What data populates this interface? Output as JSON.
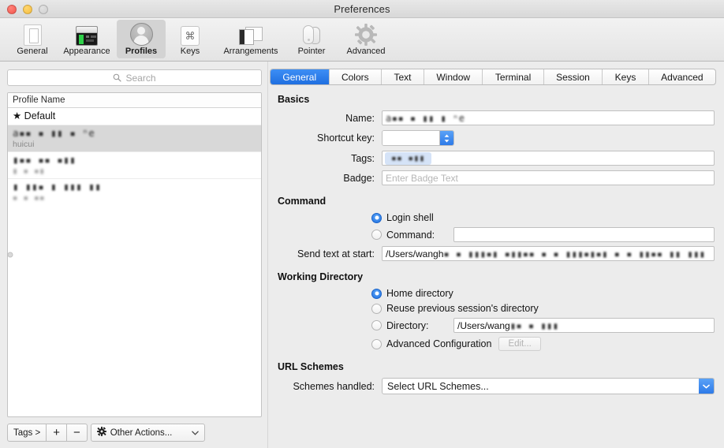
{
  "window": {
    "title": "Preferences",
    "traffic_lights": [
      "close",
      "minimize",
      "zoom"
    ]
  },
  "toolbar": {
    "items": [
      {
        "label": "General",
        "icon": "general-icon",
        "selected": false
      },
      {
        "label": "Appearance",
        "icon": "appearance-icon",
        "selected": false
      },
      {
        "label": "Profiles",
        "icon": "profiles-icon",
        "selected": true
      },
      {
        "label": "Keys",
        "icon": "keys-icon",
        "selected": false
      },
      {
        "label": "Arrangements",
        "icon": "arrangements-icon",
        "selected": false
      },
      {
        "label": "Pointer",
        "icon": "pointer-icon",
        "selected": false
      },
      {
        "label": "Advanced",
        "icon": "advanced-gear-icon",
        "selected": false
      }
    ]
  },
  "sidebar": {
    "search": {
      "placeholder": "Search",
      "value": "",
      "icon": "search-icon"
    },
    "list": {
      "column_header": "Profile Name",
      "rows": [
        {
          "title": "★ Default",
          "starred": true,
          "subtitle": "",
          "redacted": false,
          "selected": false
        },
        {
          "title": "a▪▪ ▪ ▮▮ ▪ ⁿe",
          "starred": false,
          "subtitle": "huicui",
          "redacted": true,
          "selected": true
        },
        {
          "title": "▮▪▪ ▪▪ ▪▮▮",
          "starred": false,
          "subtitle": "▮ ▪ ▪▮",
          "redacted": true,
          "selected": false
        },
        {
          "title": "▮ ▮▮▪ ▮ ▮▮▮ ▮▮",
          "starred": false,
          "subtitle": "▪ ▪ ▪▪",
          "redacted": true,
          "selected": false
        }
      ]
    },
    "buttons": {
      "tags": "Tags >",
      "add": "+",
      "remove": "−",
      "other_actions": "Other Actions...",
      "other_actions_icon": "gear-icon",
      "other_actions_chevron": "chevron-down-icon"
    }
  },
  "tabs": [
    {
      "label": "General",
      "active": true
    },
    {
      "label": "Colors",
      "active": false
    },
    {
      "label": "Text",
      "active": false
    },
    {
      "label": "Window",
      "active": false
    },
    {
      "label": "Terminal",
      "active": false
    },
    {
      "label": "Session",
      "active": false
    },
    {
      "label": "Keys",
      "active": false
    },
    {
      "label": "Advanced",
      "active": false
    }
  ],
  "general_tab": {
    "basics": {
      "heading": "Basics",
      "name": {
        "label": "Name:",
        "value": "a▪▪ ▪ ▮▮ ▮ ⁿe",
        "redacted": true
      },
      "shortcut_key": {
        "label": "Shortcut key:",
        "value": "",
        "stepper_icon": "stepper-up-down-icon"
      },
      "tags": {
        "label": "Tags:",
        "token": "▪▪ ▪▮▮",
        "redacted": true
      },
      "badge": {
        "label": "Badge:",
        "value": "",
        "placeholder": "Enter Badge Text"
      }
    },
    "command": {
      "heading": "Command",
      "login_shell": {
        "label": "Login shell",
        "selected": true
      },
      "command": {
        "label": "Command:",
        "selected": false,
        "value": ""
      },
      "send_text_at_start": {
        "label": "Send text at start:",
        "value_visible": "/Users/wangh",
        "value_redacted": "▪ ▪ ▮▮▮▪▮ ▪▮▮▪▪ ▪ ▪ ▮▮▮▪▮▪▮ ▪ ▪ ▮▮▪▪ ▮▮ ▮▮▮"
      }
    },
    "working_directory": {
      "heading": "Working Directory",
      "options": [
        {
          "label": "Home directory",
          "selected": true
        },
        {
          "label": "Reuse previous session's directory",
          "selected": false
        },
        {
          "label": "Directory:",
          "selected": false
        },
        {
          "label": "Advanced Configuration",
          "selected": false
        }
      ],
      "directory_value_visible": "/Users/wang",
      "directory_value_redacted": "▮▪ ▪ ▮▮▮",
      "edit_button": "Edit..."
    },
    "url_schemes": {
      "heading": "URL Schemes",
      "schemes_handled": {
        "label": "Schemes handled:",
        "value": "Select URL Schemes...",
        "arrow_icon": "chevron-down-icon"
      }
    }
  },
  "colors": {
    "accent_blue": "#2d7ae8",
    "tab_active": "#3d8ef5",
    "window_bg": "#ececec",
    "field_bg": "#ffffff",
    "token_bg": "#d5e3f7"
  }
}
